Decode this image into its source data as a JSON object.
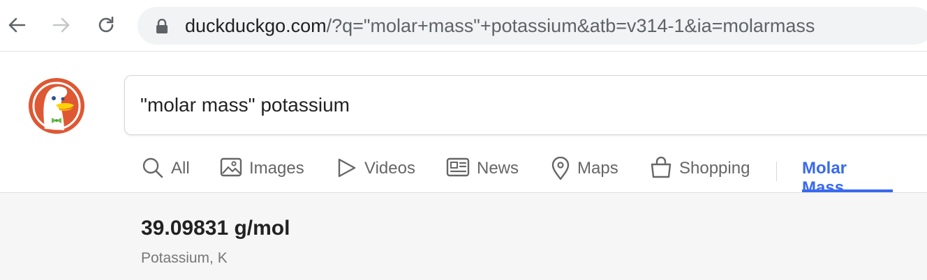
{
  "browser": {
    "url_domain": "duckduckgo.com",
    "url_path": "/?q=\"molar+mass\"+potassium&atb=v314-1&ia=molarmass"
  },
  "search": {
    "query": "\"molar mass\" potassium"
  },
  "tabs": [
    {
      "label": "All",
      "icon": "search-icon",
      "active": false
    },
    {
      "label": "Images",
      "icon": "image-icon",
      "active": false
    },
    {
      "label": "Videos",
      "icon": "play-icon",
      "active": false
    },
    {
      "label": "News",
      "icon": "newspaper-icon",
      "active": false
    },
    {
      "label": "Maps",
      "icon": "map-pin-icon",
      "active": false
    },
    {
      "label": "Shopping",
      "icon": "shopping-bag-icon",
      "active": false
    },
    {
      "label": "Molar Mass",
      "icon": "",
      "active": true
    }
  ],
  "result": {
    "value": "39.09831 g/mol",
    "element": "Potassium, K"
  },
  "colors": {
    "accent": "#3969ef",
    "logo_orange": "#de5833",
    "result_bg": "#f6f6f6"
  }
}
